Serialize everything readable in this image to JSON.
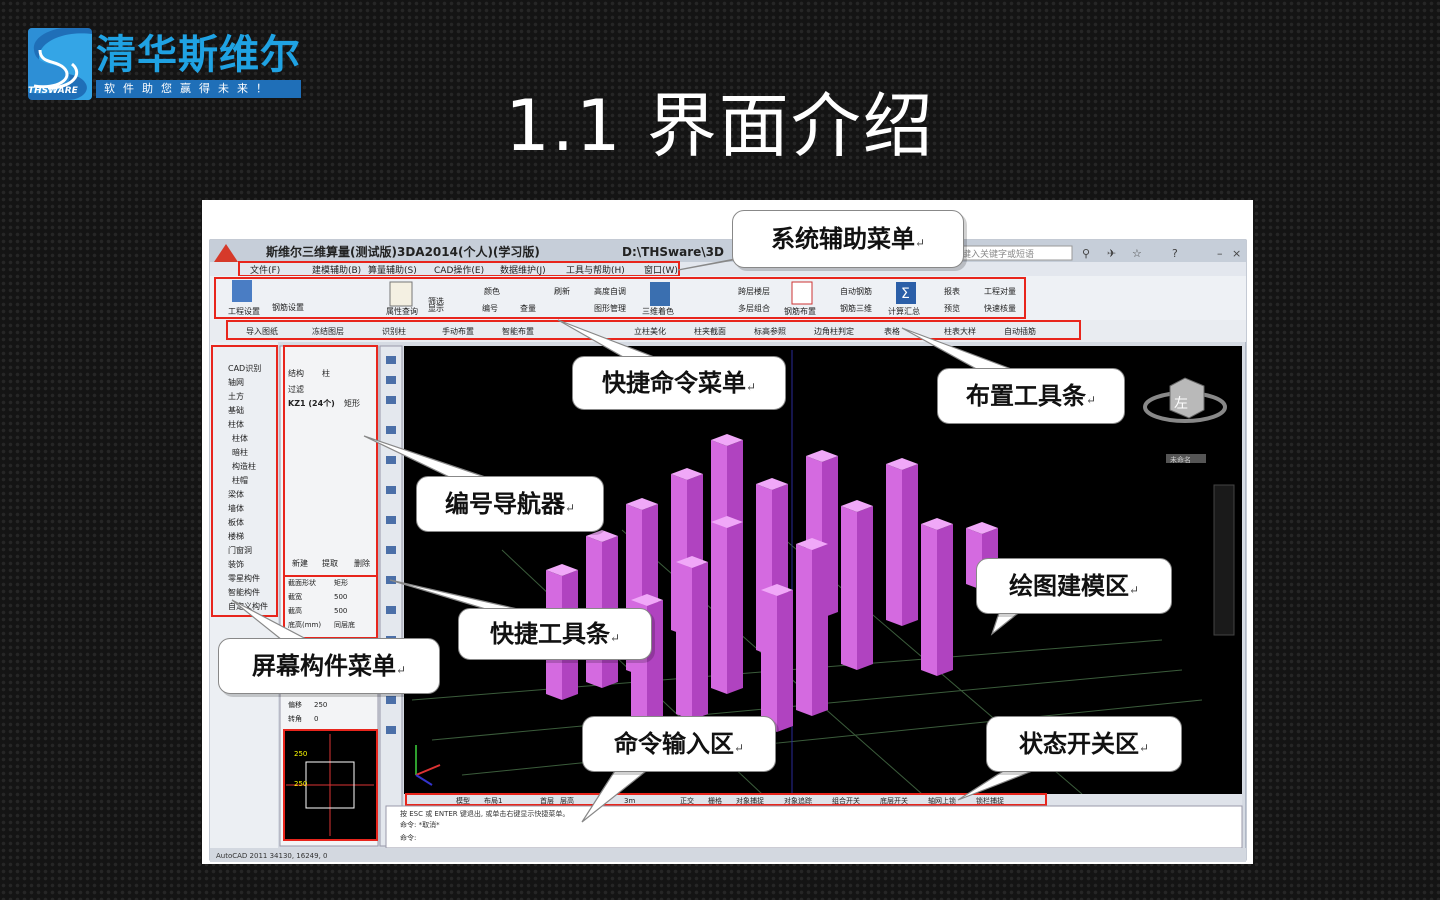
{
  "logo": {
    "name": "清华斯维尔",
    "slogan": "软件助您赢得未来！",
    "brand_en": "THSWARE"
  },
  "slide": {
    "title": "1.1 界面介绍"
  },
  "app": {
    "title": "斯维尔三维算量(测试版)3DA2014(个人)(学习版)",
    "path": "D:\\THSware\\3D",
    "search_placeholder": "键入关键字或短语",
    "menu": [
      "文件(F)",
      "建模辅助(B)",
      "算量辅助(S)",
      "CAD操作(E)",
      "数据维护(J)",
      "工具与帮助(H)",
      "窗口(W)"
    ],
    "ribbon": [
      "工程设置",
      "钢筋设置",
      "属性查询",
      "编号",
      "三维着色",
      "钢筋布置",
      "钢筋三维",
      "自动钢筋",
      "计算汇总",
      "报表",
      "预览",
      "工程对量",
      "快速核量",
      "筛选",
      "显示",
      "查量",
      "刷新",
      "高度自调",
      "图形管理",
      "多层组合",
      "跨层楼层",
      "颜色"
    ],
    "layout_toolbar": [
      "导入图纸",
      "冻结图层",
      "识别柱",
      "手动布置",
      "智能布置",
      "立柱美化",
      "柱夹截面",
      "标高参照",
      "边角柱判定",
      "表格",
      "柱表大样",
      "自动插筋"
    ],
    "component_menu": [
      "CAD识别",
      "轴网",
      "土方",
      "基础",
      "柱体",
      "柱体",
      "暗柱",
      "构造柱",
      "柱帽",
      "梁体",
      "墙体",
      "板体",
      "楼梯",
      "门窗洞",
      "装饰",
      "零星构件",
      "智能构件",
      "自定义构件"
    ],
    "navigator": {
      "type": "结构",
      "component": "柱",
      "filter": "过滤",
      "item": "KZ1 (24个)",
      "shape": "矩形",
      "buttons": [
        "新建",
        "提取",
        "删除"
      ]
    },
    "props": [
      [
        "截面形状",
        "矩形"
      ],
      [
        "截宽",
        "500"
      ],
      [
        "截高",
        "500"
      ],
      [
        "底高(mm)",
        "同层底"
      ]
    ],
    "props2": [
      [
        "偏移",
        "250"
      ],
      [
        "转角",
        "0"
      ]
    ],
    "grid_labels": [
      "250",
      "250"
    ],
    "bottom_tabs": [
      "模型",
      "布局1"
    ],
    "status_buttons": [
      "正交",
      "栅格",
      "对象捕捉",
      "对象追踪",
      "组合开关",
      "底层开关",
      "轴网上锁",
      "锁栏捕捉"
    ],
    "status_misc": [
      "首层",
      "层高",
      "3m"
    ],
    "command_lines": [
      "按 ESC 或 ENTER 键退出, 或单击右键显示快捷菜单。",
      "命令: *取消*",
      "命令:"
    ],
    "status_bar": "AutoCAD 2011    34130, 16249, 0",
    "viewcube": "左",
    "viewcube_label": "未命名"
  },
  "callouts": [
    {
      "id": "system-menu",
      "text": "系统辅助菜单"
    },
    {
      "id": "quick-command-menu",
      "text": "快捷命令菜单"
    },
    {
      "id": "layout-toolbar",
      "text": "布置工具条"
    },
    {
      "id": "code-navigator",
      "text": "编号导航器"
    },
    {
      "id": "drawing-area",
      "text": "绘图建模区"
    },
    {
      "id": "quick-toolbar",
      "text": "快捷工具条"
    },
    {
      "id": "component-menu",
      "text": "屏幕构件菜单"
    },
    {
      "id": "command-input",
      "text": "命令输入区"
    },
    {
      "id": "status-switch",
      "text": "状态开关区"
    }
  ],
  "colors": {
    "background": "#141414",
    "logo_blue": "#1fa2e3",
    "highlight_red": "#e8251c",
    "column_fill": "#cc5ad8",
    "model_bg": "#000000"
  }
}
